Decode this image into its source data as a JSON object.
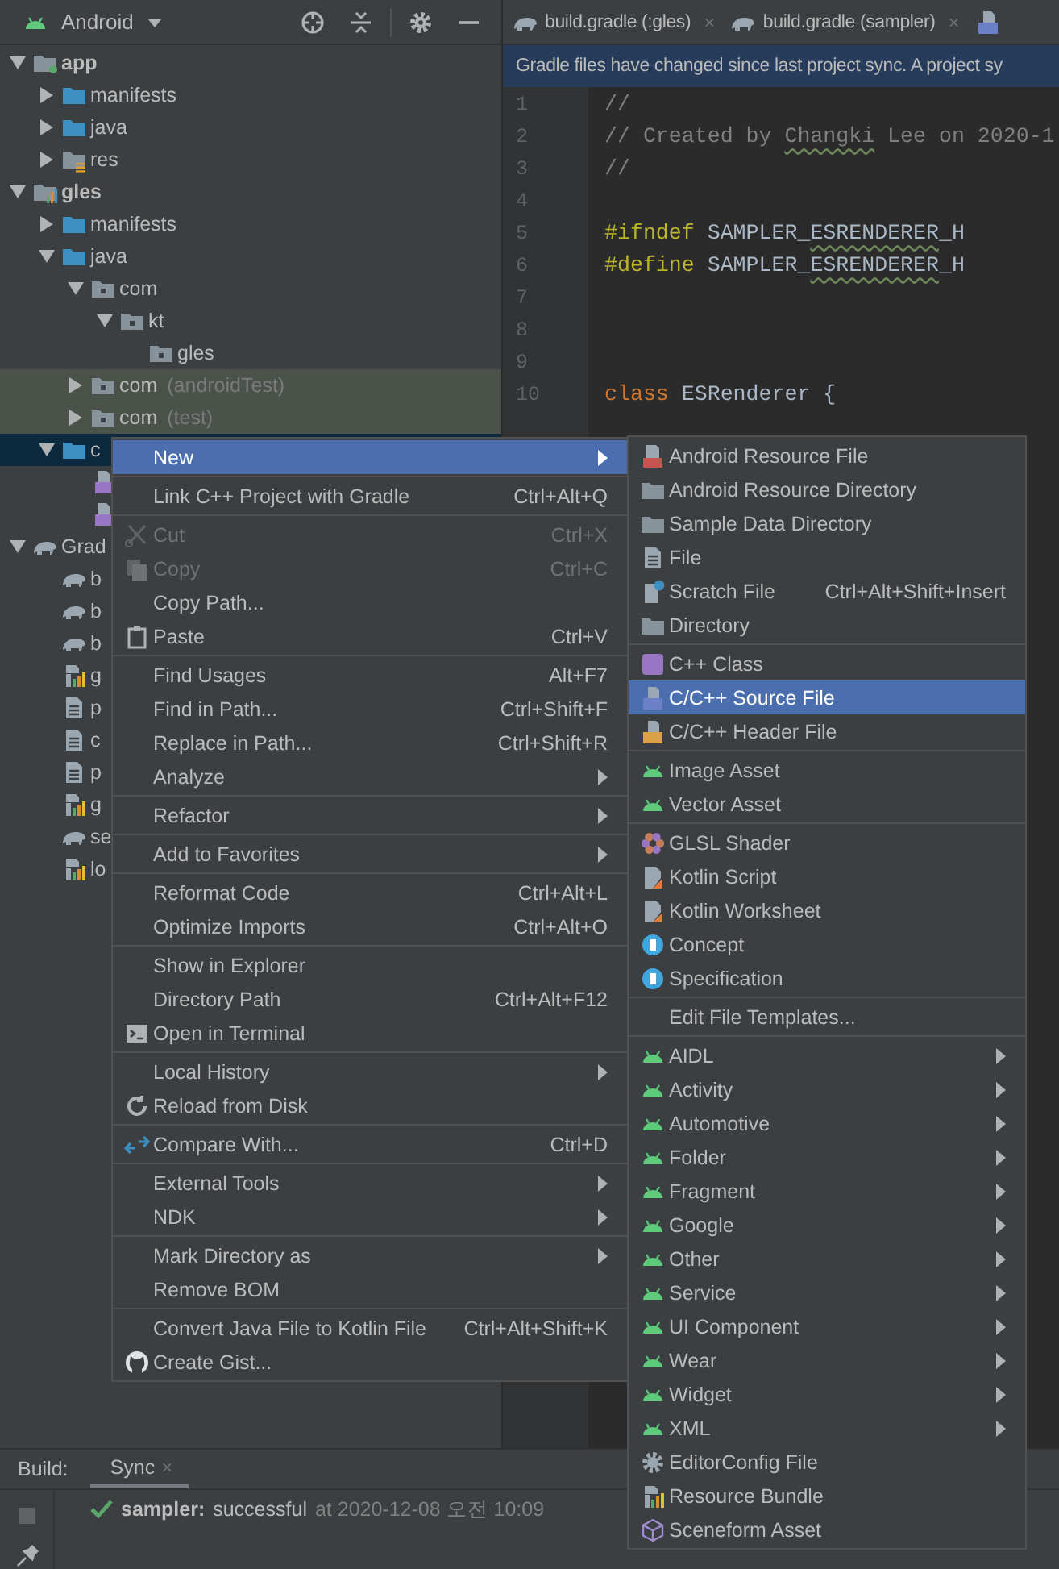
{
  "project_panel": {
    "view": "Android",
    "tree": [
      {
        "label": "app",
        "kind": "module",
        "expanded": true,
        "selected": false,
        "tinted": false,
        "children": [
          {
            "label": "manifests",
            "kind": "folder",
            "expanded": false,
            "selected": false,
            "tinted": false
          },
          {
            "label": "java",
            "kind": "folder",
            "expanded": false,
            "selected": false,
            "tinted": false
          },
          {
            "label": "res",
            "kind": "res-folder",
            "expanded": false,
            "selected": false,
            "tinted": false
          }
        ]
      },
      {
        "label": "gles",
        "kind": "module-lib",
        "expanded": true,
        "selected": false,
        "tinted": false,
        "children": [
          {
            "label": "manifests",
            "kind": "folder",
            "expanded": false,
            "selected": false,
            "tinted": false
          },
          {
            "label": "java",
            "kind": "folder",
            "expanded": true,
            "selected": false,
            "tinted": false,
            "children": [
              {
                "label": "com",
                "kind": "package",
                "expanded": true,
                "selected": false,
                "tinted": false,
                "children": [
                  {
                    "label": "kt",
                    "kind": "package",
                    "expanded": true,
                    "selected": false,
                    "tinted": false,
                    "children": [
                      {
                        "label": "gles",
                        "kind": "package",
                        "selected": false,
                        "tinted": false
                      }
                    ]
                  }
                ]
              },
              {
                "label": "com",
                "suffix": "(androidTest)",
                "kind": "package",
                "expanded": false,
                "selected": false,
                "tinted": true
              },
              {
                "label": "com",
                "suffix": "(test)",
                "kind": "package",
                "expanded": false,
                "selected": false,
                "tinted": true
              }
            ]
          },
          {
            "label": "c",
            "kind": "folder",
            "expanded": true,
            "selected": true,
            "tinted": false,
            "children": [
              {
                "kind": "cpp-file",
                "selected": false,
                "tinted": false
              },
              {
                "kind": "cpp-file",
                "selected": false,
                "tinted": false
              }
            ]
          }
        ]
      },
      {
        "label": "Grad",
        "kind": "gradle",
        "expanded": true,
        "selected": false,
        "tinted": false,
        "children": [
          {
            "label": "b",
            "kind": "gradle",
            "selected": false,
            "tinted": false
          },
          {
            "label": "b",
            "kind": "gradle",
            "selected": false,
            "tinted": false
          },
          {
            "label": "b",
            "kind": "gradle",
            "selected": false,
            "tinted": false
          },
          {
            "label": "g",
            "kind": "bars",
            "selected": false,
            "tinted": false
          },
          {
            "label": "p",
            "kind": "text-file",
            "selected": false,
            "tinted": false
          },
          {
            "label": "c",
            "kind": "text-file",
            "selected": false,
            "tinted": false
          },
          {
            "label": "p",
            "kind": "text-file",
            "selected": false,
            "tinted": false
          },
          {
            "label": "g",
            "kind": "bars",
            "selected": false,
            "tinted": false
          },
          {
            "label": "se",
            "kind": "gradle",
            "selected": false,
            "tinted": false
          },
          {
            "label": "lo",
            "kind": "bars",
            "selected": false,
            "tinted": false
          }
        ]
      }
    ]
  },
  "editor": {
    "tabs": [
      {
        "label": "build.gradle (:gles)",
        "kind": "gradle",
        "close": "×"
      },
      {
        "label": "build.gradle (sampler)",
        "kind": "gradle",
        "close": "×"
      },
      {
        "kind": "cpp-source"
      }
    ],
    "notification": "Gradle files have changed since last project sync. A project sy",
    "lines": [
      {
        "number": "1",
        "segments": [
          {
            "text": "//",
            "kind": "comment"
          }
        ]
      },
      {
        "number": "2",
        "segments": [
          {
            "text": "// Created by ",
            "kind": "comment"
          },
          {
            "text": "Changki",
            "kind": "comment-typo"
          },
          {
            "text": " Lee on 2020-1",
            "kind": "comment"
          }
        ]
      },
      {
        "number": "3",
        "segments": [
          {
            "text": "//",
            "kind": "comment"
          }
        ]
      },
      {
        "number": "4"
      },
      {
        "number": "5",
        "segments": [
          {
            "text": "#ifndef",
            "kind": "directive"
          },
          {
            "text": " SAMPLER_",
            "kind": "plain"
          },
          {
            "text": "ESRENDERER",
            "kind": "typo"
          },
          {
            "text": "_H",
            "kind": "plain"
          }
        ]
      },
      {
        "number": "6",
        "segments": [
          {
            "text": "#define",
            "kind": "directive"
          },
          {
            "text": " SAMPLER_",
            "kind": "plain"
          },
          {
            "text": "ESRENDERER",
            "kind": "typo"
          },
          {
            "text": "_H",
            "kind": "plain"
          }
        ]
      },
      {
        "number": "7"
      },
      {
        "number": "8"
      },
      {
        "number": "9"
      },
      {
        "number": "10",
        "segments": [
          {
            "text": "class",
            "kind": "keyword"
          },
          {
            "text": " ESRenderer {",
            "kind": "plain"
          }
        ]
      }
    ]
  },
  "context_menu": {
    "groups": [
      [
        {
          "label": "New",
          "selected": true,
          "disabled": false,
          "submenu": true
        }
      ],
      [
        {
          "label": "Link C++ Project with Gradle",
          "shortcut": "Ctrl+Alt+Q",
          "selected": false,
          "disabled": false,
          "submenu": false
        }
      ],
      [
        {
          "label": "Cut",
          "shortcut": "Ctrl+X",
          "kind": "scissors",
          "selected": false,
          "disabled": true,
          "submenu": false
        },
        {
          "label": "Copy",
          "shortcut": "Ctrl+C",
          "kind": "copy",
          "selected": false,
          "disabled": true,
          "submenu": false
        },
        {
          "label": "Copy Path...",
          "selected": false,
          "disabled": false,
          "submenu": false
        },
        {
          "label": "Paste",
          "shortcut": "Ctrl+V",
          "kind": "clipboard",
          "selected": false,
          "disabled": false,
          "submenu": false
        }
      ],
      [
        {
          "label": "Find Usages",
          "shortcut": "Alt+F7",
          "selected": false,
          "disabled": false,
          "submenu": false
        },
        {
          "label": "Find in Path...",
          "shortcut": "Ctrl+Shift+F",
          "selected": false,
          "disabled": false,
          "submenu": false
        },
        {
          "label": "Replace in Path...",
          "shortcut": "Ctrl+Shift+R",
          "selected": false,
          "disabled": false,
          "submenu": false
        },
        {
          "label": "Analyze",
          "selected": false,
          "disabled": false,
          "submenu": true
        }
      ],
      [
        {
          "label": "Refactor",
          "selected": false,
          "disabled": false,
          "submenu": true
        }
      ],
      [
        {
          "label": "Add to Favorites",
          "selected": false,
          "disabled": false,
          "submenu": true
        }
      ],
      [
        {
          "label": "Reformat Code",
          "shortcut": "Ctrl+Alt+L",
          "selected": false,
          "disabled": false,
          "submenu": false
        },
        {
          "label": "Optimize Imports",
          "shortcut": "Ctrl+Alt+O",
          "selected": false,
          "disabled": false,
          "submenu": false
        }
      ],
      [
        {
          "label": "Show in Explorer",
          "selected": false,
          "disabled": false,
          "submenu": false
        },
        {
          "label": "Directory Path",
          "shortcut": "Ctrl+Alt+F12",
          "selected": false,
          "disabled": false,
          "submenu": false
        },
        {
          "label": "Open in Terminal",
          "kind": "terminal",
          "selected": false,
          "disabled": false,
          "submenu": false
        }
      ],
      [
        {
          "label": "Local History",
          "selected": false,
          "disabled": false,
          "submenu": true
        },
        {
          "label": "Reload from Disk",
          "kind": "reload",
          "selected": false,
          "disabled": false,
          "submenu": false
        }
      ],
      [
        {
          "label": "Compare With...",
          "shortcut": "Ctrl+D",
          "kind": "compare",
          "selected": false,
          "disabled": false,
          "submenu": false
        }
      ],
      [
        {
          "label": "External Tools",
          "selected": false,
          "disabled": false,
          "submenu": true
        },
        {
          "label": "NDK",
          "selected": false,
          "disabled": false,
          "submenu": true
        }
      ],
      [
        {
          "label": "Mark Directory as",
          "selected": false,
          "disabled": false,
          "submenu": true
        },
        {
          "label": "Remove BOM",
          "selected": false,
          "disabled": false,
          "submenu": false
        }
      ],
      [
        {
          "label": "Convert Java File to Kotlin File",
          "shortcut": "Ctrl+Alt+Shift+K",
          "selected": false,
          "disabled": false,
          "submenu": false
        },
        {
          "label": "Create Gist...",
          "kind": "cat",
          "selected": false,
          "disabled": false,
          "submenu": false
        }
      ]
    ]
  },
  "new_submenu": {
    "groups": [
      [
        {
          "label": "Android Resource File",
          "kind": "res-file",
          "selected": false,
          "submenu": false
        },
        {
          "label": "Android Resource Directory",
          "kind": "folder-gray",
          "selected": false,
          "submenu": false
        },
        {
          "label": "Sample Data Directory",
          "kind": "folder-gray",
          "selected": false,
          "submenu": false
        },
        {
          "label": "File",
          "kind": "text-file",
          "selected": false,
          "submenu": false
        },
        {
          "label": "Scratch File",
          "shortcut": "Ctrl+Alt+Shift+Insert",
          "kind": "scratch",
          "selected": false,
          "submenu": false
        },
        {
          "label": "Directory",
          "kind": "folder-gray",
          "selected": false,
          "submenu": false
        }
      ],
      [
        {
          "label": "C++ Class",
          "kind": "cpp-class",
          "selected": false,
          "submenu": false
        },
        {
          "label": "C/C++ Source File",
          "kind": "cpp-source",
          "selected": true,
          "submenu": false
        },
        {
          "label": "C/C++ Header File",
          "kind": "cpp-header",
          "selected": false,
          "submenu": false
        }
      ],
      [
        {
          "label": "Image Asset",
          "kind": "android",
          "selected": false,
          "submenu": false
        },
        {
          "label": "Vector Asset",
          "kind": "android",
          "selected": false,
          "submenu": false
        }
      ],
      [
        {
          "label": "GLSL Shader",
          "kind": "shader",
          "selected": false,
          "submenu": false
        },
        {
          "label": "Kotlin Script",
          "kind": "kotlin",
          "selected": false,
          "submenu": false
        },
        {
          "label": "Kotlin Worksheet",
          "kind": "kotlin",
          "selected": false,
          "submenu": false
        },
        {
          "label": "Concept",
          "kind": "concept",
          "selected": false,
          "submenu": false
        },
        {
          "label": "Specification",
          "kind": "concept",
          "selected": false,
          "submenu": false
        }
      ],
      [
        {
          "label": "Edit File Templates...",
          "selected": false,
          "submenu": false
        }
      ],
      [
        {
          "label": "AIDL",
          "kind": "android",
          "selected": false,
          "submenu": true
        },
        {
          "label": "Activity",
          "kind": "android",
          "selected": false,
          "submenu": true
        },
        {
          "label": "Automotive",
          "kind": "android",
          "selected": false,
          "submenu": true
        },
        {
          "label": "Folder",
          "kind": "android",
          "selected": false,
          "submenu": true
        },
        {
          "label": "Fragment",
          "kind": "android",
          "selected": false,
          "submenu": true
        },
        {
          "label": "Google",
          "kind": "android",
          "selected": false,
          "submenu": true
        },
        {
          "label": "Other",
          "kind": "android",
          "selected": false,
          "submenu": true
        },
        {
          "label": "Service",
          "kind": "android",
          "selected": false,
          "submenu": true
        },
        {
          "label": "UI Component",
          "kind": "android",
          "selected": false,
          "submenu": true
        },
        {
          "label": "Wear",
          "kind": "android",
          "selected": false,
          "submenu": true
        },
        {
          "label": "Widget",
          "kind": "android",
          "selected": false,
          "submenu": true
        },
        {
          "label": "XML",
          "kind": "android",
          "selected": false,
          "submenu": true
        },
        {
          "label": "EditorConfig File",
          "kind": "gear",
          "selected": false,
          "submenu": false
        },
        {
          "label": "Resource Bundle",
          "kind": "bars",
          "selected": false,
          "submenu": false
        },
        {
          "label": "Sceneform Asset",
          "kind": "cube",
          "selected": false,
          "submenu": false
        }
      ]
    ]
  },
  "build_panel": {
    "title": "Build:",
    "tabs": [
      {
        "label": "Sync",
        "close": "×",
        "selected": true
      }
    ],
    "message": {
      "project": "sampler:",
      "status": "successful",
      "time": "at 2020-12-08 오전 10:09"
    }
  }
}
